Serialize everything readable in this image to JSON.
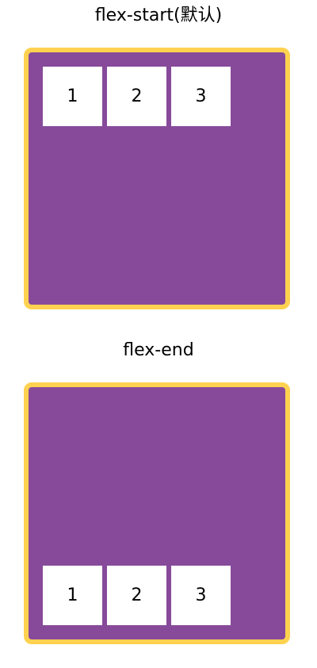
{
  "demos": [
    {
      "title": "flex-start(默认)",
      "items": [
        "1",
        "2",
        "3"
      ]
    },
    {
      "title": "flex-end",
      "items": [
        "1",
        "2",
        "3"
      ]
    }
  ],
  "colors": {
    "container_background": "#874a9a",
    "container_border": "#fed250",
    "item_background": "#ffffff",
    "text": "#000000"
  }
}
